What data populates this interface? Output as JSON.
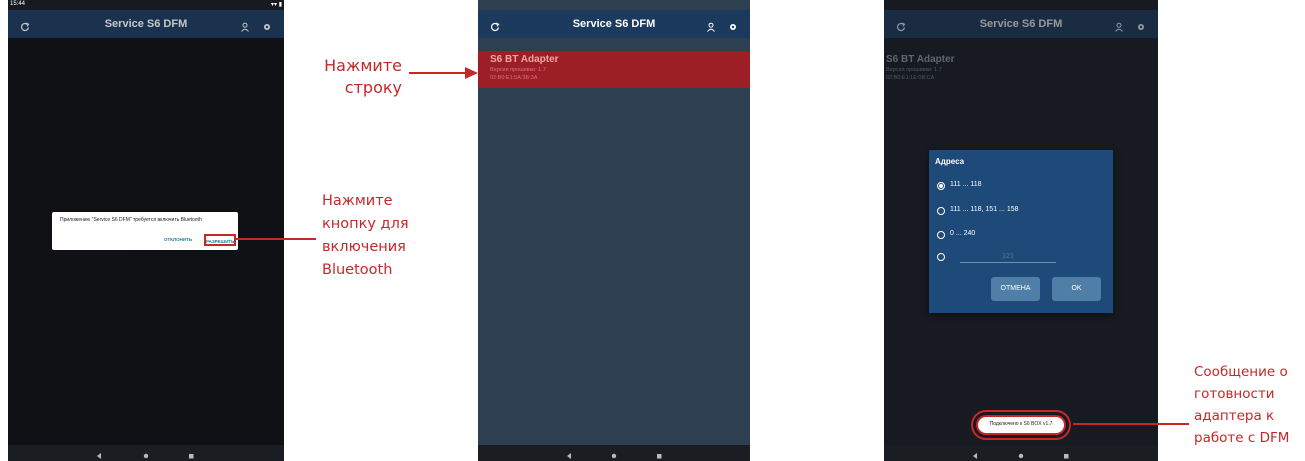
{
  "app": {
    "title": "Service S6 DFM",
    "status_time": "15:44",
    "status_right": "▾▾ ▮"
  },
  "screen1": {
    "dialog_text": "Приложению \"Service S6 DFM\" требуется включить Bluetooth",
    "deny_label": "ОТКЛОНИТЬ",
    "allow_label": "РАЗРЕШИТЬ"
  },
  "screen2": {
    "device": {
      "name": "S6 BT Adapter",
      "firmware": "Версия прошивки: 1.7",
      "mac": "02:B0:E1:5A:3B:3A"
    }
  },
  "screen3": {
    "device": {
      "name": "S6 BT Adapter",
      "firmware": "Версия прошивки: 1.7",
      "mac": "02:B0:E1:1E:0B:CA"
    },
    "address_dialog": {
      "title": "Адреса",
      "options": [
        {
          "label": "111 ... 118",
          "selected": true
        },
        {
          "label": "111 ... 118, 151 ... 158",
          "selected": false
        },
        {
          "label": "0 ... 240",
          "selected": false
        }
      ],
      "custom_placeholder": "121",
      "cancel_label": "ОТМЕНА",
      "ok_label": "OK"
    },
    "toast": "Подключено к S6 BOX v1.7"
  },
  "annotations": {
    "press_row": "Нажмите\nстроку",
    "press_button": "Нажмите\nкнопку для\nвключения\nBluetooth",
    "ready_message": "Сообщение о\nготовности\nадаптера к\nработе с DFM"
  },
  "colors": {
    "appbar": "#1c3a5e",
    "screen_bg": "#171b21",
    "list_bg": "#2d3f51",
    "selected_row": "#9c1f26",
    "dialog_bg": "#1d4a78",
    "annotation": "#c62828"
  }
}
